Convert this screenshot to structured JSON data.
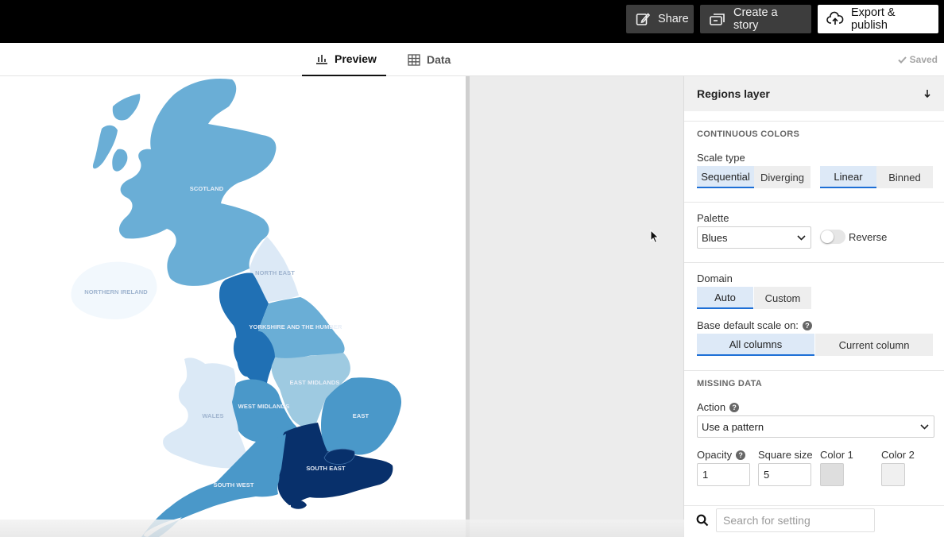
{
  "topbar": {
    "share_label": "Share",
    "story_label": "Create a story",
    "export_label": "Export & publish"
  },
  "tabs": {
    "preview_label": "Preview",
    "data_label": "Data",
    "saved_label": "Saved"
  },
  "map": {
    "regions": {
      "scotland": "SCOTLAND",
      "northern_ireland": "NORTHERN IRELAND",
      "north_east": "NORTH EAST",
      "yorkshire": "YORKSHIRE AND THE HUMBER",
      "east_midlands": "EAST MIDLANDS",
      "west_midlands": "WEST MIDLANDS",
      "wales": "WALES",
      "east": "EAST",
      "south_east": "SOUTH EAST",
      "south_west": "SOUTH WEST"
    },
    "colors": {
      "scotland": "#6aaed6",
      "northern_ireland": "#f2f8fd",
      "north_east": "#dce9f6",
      "north_west": "#2070b4",
      "yorkshire": "#6aaed6",
      "east_midlands": "#9ecae1",
      "west_midlands": "#4a98c9",
      "wales": "#dbe9f6",
      "east": "#4a98c9",
      "london": "#08306b",
      "south_east": "#08306b",
      "south_west": "#4a98c9"
    }
  },
  "sidebar": {
    "panel_title": "Regions layer",
    "continuous_colors": {
      "title": "CONTINUOUS COLORS",
      "scale_type_label": "Scale type",
      "sequential": "Sequential",
      "diverging": "Diverging",
      "linear": "Linear",
      "binned": "Binned"
    },
    "palette": {
      "label": "Palette",
      "value": "Blues",
      "reverse_label": "Reverse"
    },
    "domain": {
      "label": "Domain",
      "auto": "Auto",
      "custom": "Custom",
      "base_label": "Base default scale on:",
      "all_columns": "All columns",
      "current_column": "Current column"
    },
    "missing_data": {
      "title": "MISSING DATA",
      "action_label": "Action",
      "action_value": "Use a pattern",
      "opacity_label": "Opacity",
      "opacity_value": "1",
      "square_size_label": "Square size",
      "square_size_value": "5",
      "color1_label": "Color 1",
      "color1": "#dedede",
      "color2_label": "Color 2",
      "color2": "#f0f0f0"
    },
    "search_placeholder": "Search for setting"
  }
}
